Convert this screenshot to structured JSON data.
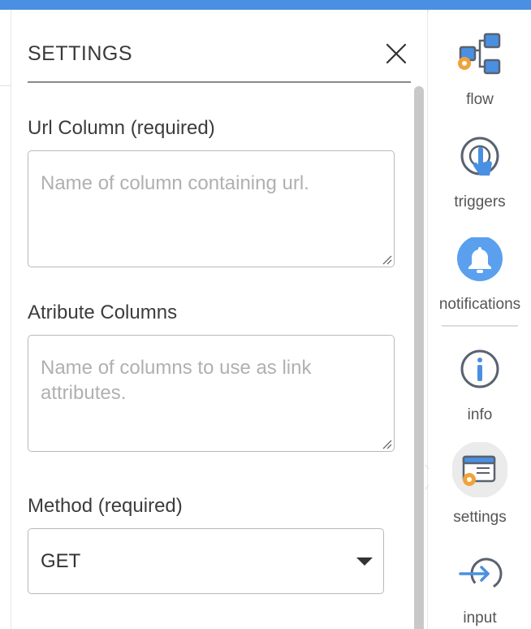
{
  "panel": {
    "title": "SETTINGS",
    "close_icon": "close-icon"
  },
  "fields": {
    "url_column": {
      "label": "Url Column (required)",
      "value": "",
      "placeholder": "Name of column containing url."
    },
    "attribute_columns": {
      "label": "Atribute Columns",
      "value": "",
      "placeholder": "Name of columns to use as link attributes."
    },
    "method": {
      "label": "Method (required)",
      "selected": "GET"
    }
  },
  "rail": {
    "items": [
      {
        "label": "flow",
        "icon": "flow-icon"
      },
      {
        "label": "triggers",
        "icon": "pointer-hand-icon"
      },
      {
        "label": "notifications",
        "icon": "bell-icon"
      },
      {
        "label": "info",
        "icon": "info-icon"
      },
      {
        "label": "settings",
        "icon": "settings-window-icon",
        "active": true
      },
      {
        "label": "input",
        "icon": "input-arrow-icon"
      }
    ]
  },
  "colors": {
    "accent": "#4a90e2",
    "gear": "#f0a33a",
    "icon_dark": "#5a6270",
    "active_bg": "#ebebeb"
  }
}
